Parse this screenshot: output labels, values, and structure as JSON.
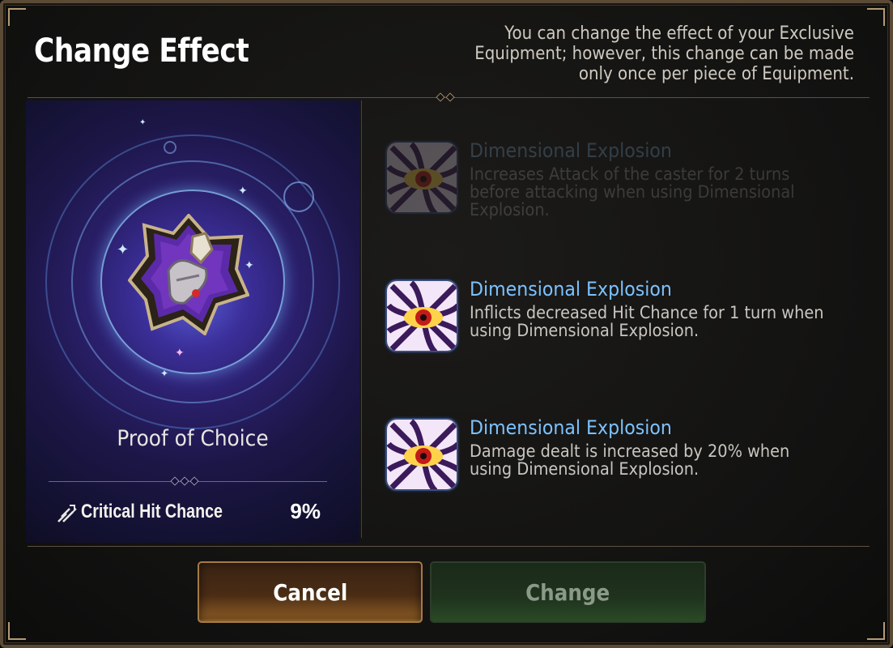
{
  "header": {
    "title": "Change Effect",
    "description": "You can change the effect of your Exclusive Equipment; however, this change can be made only once per piece of Equipment."
  },
  "equipment": {
    "name": "Proof of Choice",
    "stat_label": "Critical Hit Chance",
    "stat_value": "9%",
    "stat_icon": "crit-chance-icon",
    "badge_icon": "proof-of-choice-emblem"
  },
  "options": [
    {
      "title": "Dimensional Explosion",
      "description": "Increases Attack of the caster for 2 turns before attacking when using Dimensional Explosion.",
      "icon": "dimensional-eye-icon",
      "state": "current"
    },
    {
      "title": "Dimensional Explosion",
      "description": "Inflicts decreased Hit Chance for 1 turn when using Dimensional Explosion.",
      "icon": "dimensional-eye-icon",
      "state": "available"
    },
    {
      "title": "Dimensional Explosion",
      "description": "Damage dealt is increased by 20% when using Dimensional Explosion.",
      "icon": "dimensional-eye-icon",
      "state": "available"
    }
  ],
  "buttons": {
    "cancel": "Cancel",
    "change": "Change"
  },
  "colors": {
    "skill_title": "#7cc2ff",
    "frame_gold": "#b49a72",
    "cancel_button": "#8a5a24",
    "change_button_disabled": "#1f331d"
  }
}
